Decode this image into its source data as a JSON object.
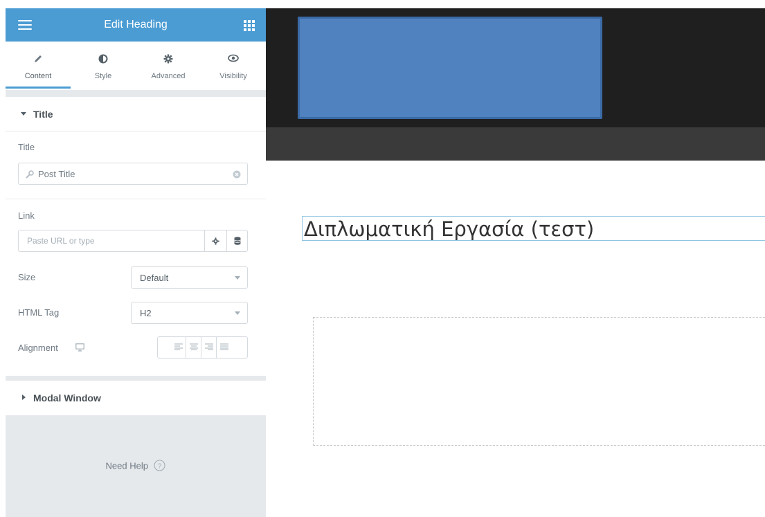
{
  "panel": {
    "title": "Edit Heading",
    "tabs": [
      {
        "label": "Content",
        "icon": "pencil-icon",
        "active": true
      },
      {
        "label": "Style",
        "icon": "contrast-icon",
        "active": false
      },
      {
        "label": "Advanced",
        "icon": "gear-icon",
        "active": false
      },
      {
        "label": "Visibility",
        "icon": "eye-icon",
        "active": false
      }
    ],
    "title_section": {
      "heading": "Title",
      "title_label": "Title",
      "title_value": "Post Title",
      "link_label": "Link",
      "link_placeholder": "Paste URL or type",
      "size_label": "Size",
      "size_value": "Default",
      "html_tag_label": "HTML Tag",
      "html_tag_value": "H2",
      "alignment_label": "Alignment"
    },
    "modal_section": {
      "heading": "Modal Window"
    },
    "help": {
      "label": "Need Help"
    }
  },
  "preview": {
    "heading": "Διπλωματική Εργασία (τεστ)"
  },
  "colors": {
    "accent": "#4b9cd3",
    "logo": "#4f82bf",
    "header_bg": "#1f1f1f",
    "nav_bg": "#3a3a3a"
  }
}
